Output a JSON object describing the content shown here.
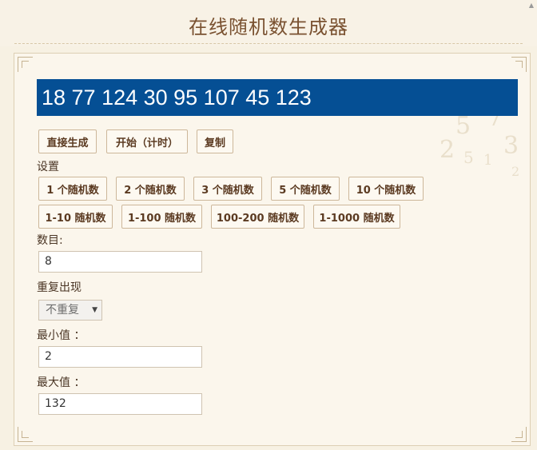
{
  "header": {
    "title": "在线随机数生成器"
  },
  "result": {
    "text": "18 77 124 30 95 107 45 123"
  },
  "actions": {
    "generate": "直接生成",
    "start": "开始（计时）",
    "copy": "复制"
  },
  "settings": {
    "label": "设置",
    "count_presets": [
      "1 个随机数",
      "2 个随机数",
      "3 个随机数",
      "5 个随机数",
      "10 个随机数"
    ],
    "range_presets": [
      "1-10 随机数",
      "1-100 随机数",
      "100-200 随机数",
      "1-1000 随机数"
    ]
  },
  "form": {
    "count_label": "数目:",
    "count_value": "8",
    "repeat_label": "重复出现",
    "repeat_value": "不重复",
    "min_label": "最小值 ：",
    "min_value": "2",
    "max_label": "最大值 ：",
    "max_value": "132"
  },
  "decor": {
    "watermark_digits": [
      "5",
      "7",
      "2",
      "3",
      "5",
      "1",
      "2"
    ],
    "corner_icon": "corner-ornament-icon",
    "scroll_icon": "scroll-up-arrow-icon",
    "colors": {
      "result_bg": "#054f94",
      "page_bg": "#f7f1e3",
      "button_text": "#5b3a21",
      "title_text": "#7a5231"
    }
  }
}
